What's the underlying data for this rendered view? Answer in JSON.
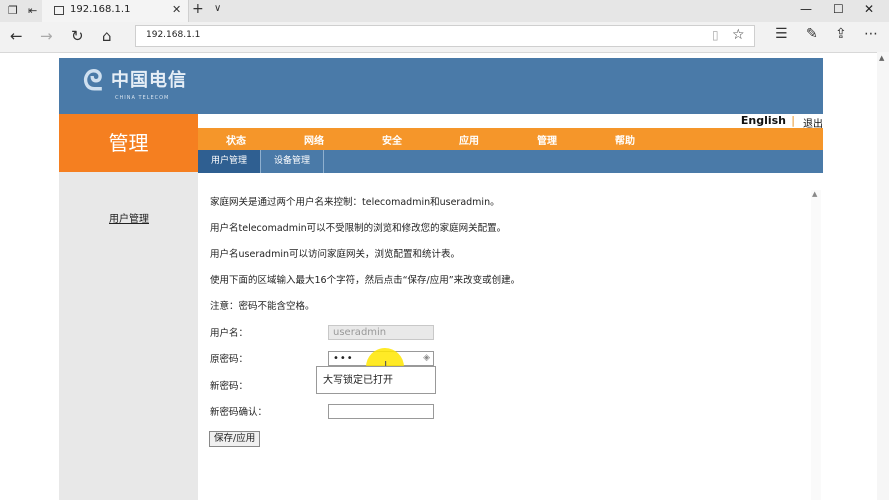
{
  "browser": {
    "tab_title": "192.168.1.1",
    "url": "192.168.1.1",
    "new_tab": "+",
    "tab_menu": "∨",
    "window": {
      "minimize": "—",
      "maximize": "☐",
      "close": "✕"
    }
  },
  "router": {
    "logo_text": "中国电信",
    "logo_sub": "CHINA TELECOM",
    "lang_link": "English",
    "lang_sep": "|",
    "logout": "退出",
    "section_title": "管理",
    "main_nav": [
      "状态",
      "网络",
      "安全",
      "应用",
      "管理",
      "帮助"
    ],
    "sub_nav": [
      "用户管理",
      "设备管理"
    ],
    "sidebar_link": "用户管理",
    "paragraphs": [
      "家庭网关是通过两个用户名来控制：telecomadmin和useradmin。",
      "用户名telecomadmin可以不受限制的浏览和修改您的家庭网关配置。",
      "用户名useradmin可以访问家庭网关，浏览配置和统计表。",
      "使用下面的区域输入最大16个字符，然后点击“保存/应用”来改变或创建。",
      "注意：密码不能含空格。"
    ],
    "form": {
      "username_label": "用户名：",
      "username_value": "useradmin",
      "old_password_label": "原密码：",
      "old_password_mask": "•••",
      "new_password_label": "新密码：",
      "confirm_label": "新密码确认：",
      "capslock_tooltip": "大写锁定已打开",
      "save_button": "保存/应用"
    }
  }
}
